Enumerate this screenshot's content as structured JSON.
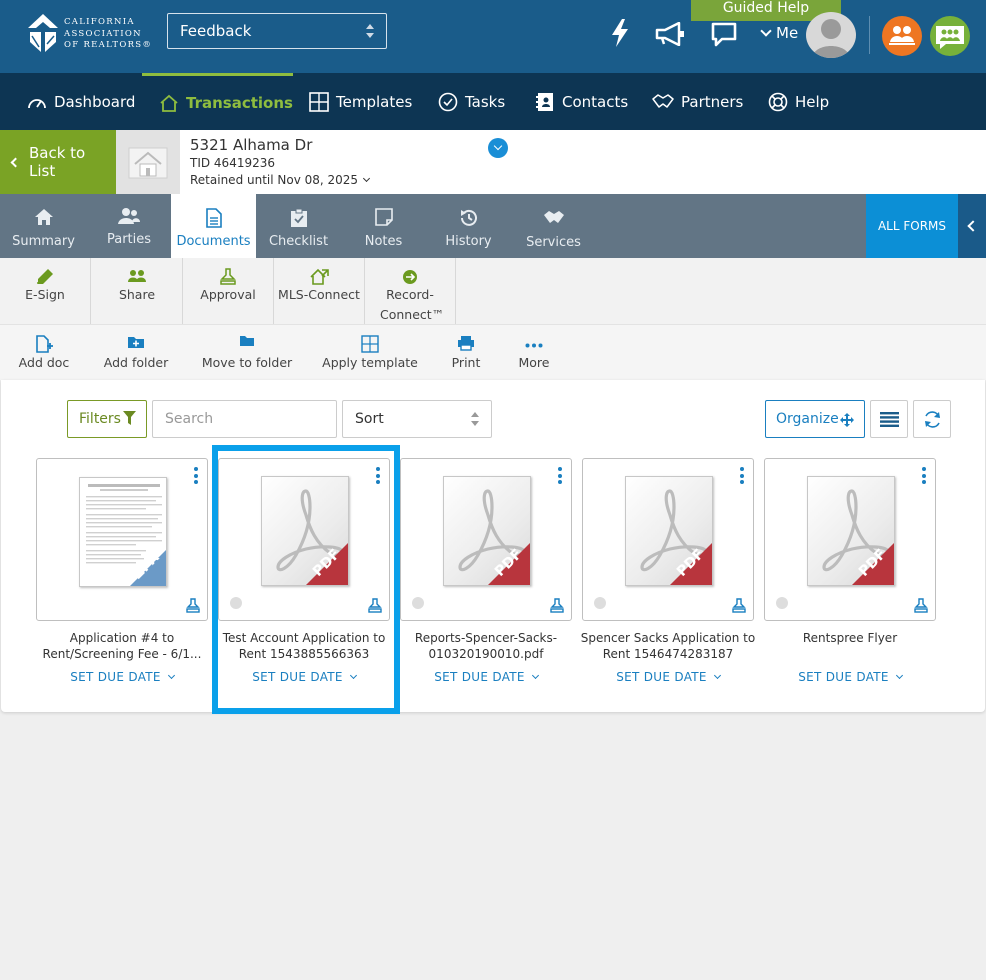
{
  "header": {
    "logo_lines": [
      "CALIFORNIA",
      "ASSOCIATION",
      "OF REALTORS®"
    ],
    "feedback_select": "Feedback",
    "guided_help": "Guided Help",
    "me_label": "Me"
  },
  "mainnav": {
    "items": [
      {
        "label": "Dashboard",
        "icon": "gauge-icon"
      },
      {
        "label": "Transactions",
        "icon": "house-icon",
        "active": true
      },
      {
        "label": "Templates",
        "icon": "grid-icon"
      },
      {
        "label": "Tasks",
        "icon": "check-circle-icon"
      },
      {
        "label": "Contacts",
        "icon": "contact-book-icon"
      },
      {
        "label": "Partners",
        "icon": "handshake-icon"
      },
      {
        "label": "Help",
        "icon": "lifebuoy-icon"
      }
    ]
  },
  "transaction": {
    "back_label": "Back to List",
    "address": "5321 Alhama Dr",
    "tid": "TID 46419236",
    "retained": "Retained until Nov 08, 2025"
  },
  "subtabs": {
    "items": [
      {
        "label": "Summary"
      },
      {
        "label": "Parties"
      },
      {
        "label": "Documents",
        "active": true
      },
      {
        "label": "Checklist"
      },
      {
        "label": "Notes"
      },
      {
        "label": "History"
      },
      {
        "label": "Services"
      }
    ],
    "all_forms": "ALL FORMS"
  },
  "actions_primary": [
    {
      "label": "E-Sign"
    },
    {
      "label": "Share"
    },
    {
      "label": "Approval"
    },
    {
      "label": "MLS-Connect"
    },
    {
      "label": "Record-Connect™"
    }
  ],
  "actions_secondary": [
    {
      "label": "Add doc"
    },
    {
      "label": "Add folder"
    },
    {
      "label": "Move to folder"
    },
    {
      "label": "Apply template"
    },
    {
      "label": "Print"
    },
    {
      "label": "More"
    }
  ],
  "toolbar": {
    "filters_label": "Filters",
    "search_placeholder": "Search",
    "sort_label": "Sort",
    "organize_label": "Organize"
  },
  "documents": [
    {
      "name": "Application #4 to Rent/Screening Fee - 6/1...",
      "badge": "ZFX",
      "due_label": "SET DUE DATE"
    },
    {
      "name": "Test Account Application to Rent 1543885566363",
      "badge": "PDF",
      "due_label": "SET DUE DATE",
      "selected": true
    },
    {
      "name": "Reports-Spencer-Sacks-010320190010.pdf",
      "badge": "PDF",
      "due_label": "SET DUE DATE"
    },
    {
      "name": "Spencer Sacks Application to Rent 1546474283187",
      "badge": "PDF",
      "due_label": "SET DUE DATE"
    },
    {
      "name": "Rentspree Flyer",
      "badge": "PDF",
      "due_label": "SET DUE DATE"
    }
  ],
  "colors": {
    "header_blue": "#1a5c8a",
    "nav_dark": "#0d3553",
    "accent_green": "#7aa325",
    "accent_blue": "#1a7fc0",
    "selection_blue": "#0aa0ea",
    "pdf_red": "#b8353d"
  }
}
